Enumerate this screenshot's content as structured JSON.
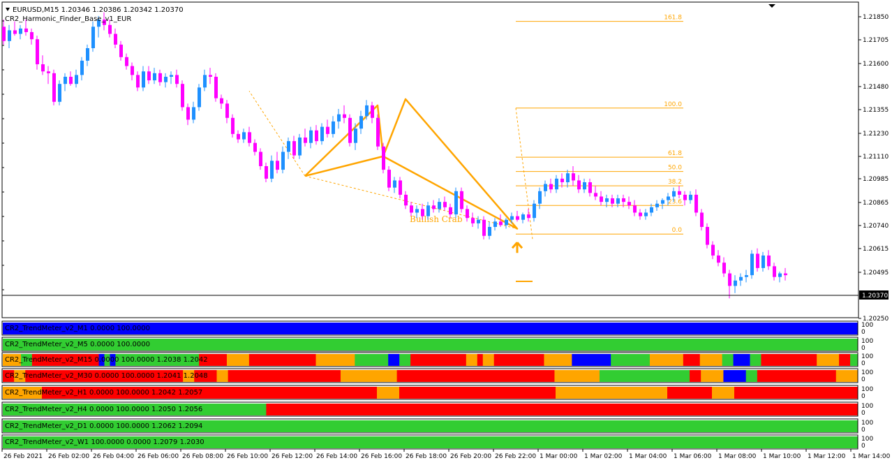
{
  "header": {
    "symbol_line": "EURUSD,M15  1.20346 1.20386 1.20342 1.20370",
    "indicator_name": "CR2_Harmonic_Finder_Base_v1_EUR"
  },
  "price_axis": {
    "labels": [
      "1.21850",
      "1.21705",
      "1.21600",
      "1.21480",
      "1.21355",
      "1.21230",
      "1.21110",
      "1.20985",
      "1.20865",
      "1.20740",
      "1.20615",
      "1.20495",
      "1.20250"
    ],
    "current_price": "1.20370"
  },
  "fibonacci": [
    {
      "level": "161.8"
    },
    {
      "level": "100.0"
    },
    {
      "level": "61.8"
    },
    {
      "level": "50.0"
    },
    {
      "level": "38.2"
    },
    {
      "level": "23.6"
    },
    {
      "level": "0.0"
    }
  ],
  "pattern_label": "Bullish Crab",
  "colors": {
    "bull": "#1E90FF",
    "bear": "#FF00FF",
    "pattern": "#FFA500",
    "red": "#FF0000",
    "green": "#32CD32",
    "orange": "#FFA500",
    "blue": "#0000FF"
  },
  "panels": [
    {
      "label": "CR2_TrendMeter_v2_M1 0.0000 100.0000",
      "scale_top": "100",
      "scale_bottom": "0",
      "segments": [
        {
          "color": "blue",
          "w": 1
        }
      ]
    },
    {
      "label": "CR2_TrendMeter_v2_M5 0.0000 100.0000",
      "scale_top": "100",
      "scale_bottom": "0",
      "segments": [
        {
          "color": "green",
          "w": 1
        }
      ]
    },
    {
      "label": "CR2_TrendMeter_v2_M15 0.0000 100.0000 1.2038 1.2042",
      "scale_top": "100",
      "scale_bottom": "0",
      "segments": [
        {
          "color": "orange",
          "w": 26
        },
        {
          "color": "green",
          "w": 16
        },
        {
          "color": "red",
          "w": 96
        },
        {
          "color": "blue",
          "w": 8
        },
        {
          "color": "green",
          "w": 8
        },
        {
          "color": "blue",
          "w": 8
        },
        {
          "color": "green",
          "w": 120
        },
        {
          "color": "red",
          "w": 40
        },
        {
          "color": "orange",
          "w": 32
        },
        {
          "color": "red",
          "w": 96
        },
        {
          "color": "orange",
          "w": 56
        },
        {
          "color": "green",
          "w": 48
        },
        {
          "color": "blue",
          "w": 16
        },
        {
          "color": "green",
          "w": 16
        },
        {
          "color": "red",
          "w": 80
        },
        {
          "color": "orange",
          "w": 16
        },
        {
          "color": "red",
          "w": 8
        },
        {
          "color": "orange",
          "w": 16
        },
        {
          "color": "red",
          "w": 72
        },
        {
          "color": "orange",
          "w": 40
        },
        {
          "color": "blue",
          "w": 56
        },
        {
          "color": "green",
          "w": 56
        },
        {
          "color": "orange",
          "w": 48
        },
        {
          "color": "red",
          "w": 24
        },
        {
          "color": "orange",
          "w": 8
        },
        {
          "color": "orange",
          "w": 24
        },
        {
          "color": "green",
          "w": 16
        },
        {
          "color": "blue",
          "w": 24
        },
        {
          "color": "green",
          "w": 16
        },
        {
          "color": "red",
          "w": 80
        },
        {
          "color": "orange",
          "w": 32
        },
        {
          "color": "red",
          "w": 16
        },
        {
          "color": "green",
          "w": 10
        }
      ]
    },
    {
      "label": "CR2_TrendMeter_v2_M30 0.0000 100.0000 1.2041 1.2048",
      "scale_top": "100",
      "scale_bottom": "0",
      "segments": [
        {
          "color": "red",
          "w": 16
        },
        {
          "color": "orange",
          "w": 16
        },
        {
          "color": "red",
          "w": 224
        },
        {
          "color": "orange",
          "w": 16
        },
        {
          "color": "red",
          "w": 32
        },
        {
          "color": "orange",
          "w": 16
        },
        {
          "color": "red",
          "w": 160
        },
        {
          "color": "orange",
          "w": 80
        },
        {
          "color": "red",
          "w": 224
        },
        {
          "color": "orange",
          "w": 64
        },
        {
          "color": "green",
          "w": 128
        },
        {
          "color": "red",
          "w": 16
        },
        {
          "color": "orange",
          "w": 32
        },
        {
          "color": "blue",
          "w": 32
        },
        {
          "color": "green",
          "w": 16
        },
        {
          "color": "red",
          "w": 112
        },
        {
          "color": "orange",
          "w": 30
        }
      ]
    },
    {
      "label": "CR2_TrendMeter_v2_H1 0.0000 100.0000 1.2042 1.2057",
      "scale_top": "100",
      "scale_bottom": "0",
      "segments": [
        {
          "color": "orange",
          "w": 56
        },
        {
          "color": "red",
          "w": 480
        },
        {
          "color": "orange",
          "w": 32
        },
        {
          "color": "red",
          "w": 224
        },
        {
          "color": "orange",
          "w": 160
        },
        {
          "color": "red",
          "w": 64
        },
        {
          "color": "orange",
          "w": 32
        },
        {
          "color": "red",
          "w": 176
        }
      ]
    },
    {
      "label": "CR2_TrendMeter_v2_H4 0.0000 100.0000 1.2050 1.2056",
      "scale_top": "100",
      "scale_bottom": "0",
      "segments": [
        {
          "color": "green",
          "w": 378
        },
        {
          "color": "red",
          "w": 848
        }
      ]
    },
    {
      "label": "CR2_TrendMeter_v2_D1 0.0000 100.0000 1.2062 1.2094",
      "scale_top": "100",
      "scale_bottom": "0",
      "segments": [
        {
          "color": "green",
          "w": 1
        }
      ]
    },
    {
      "label": "CR2_TrendMeter_v2_W1 100.0000 0.0000 1.2079 1.2030",
      "scale_top": "100",
      "scale_bottom": "0",
      "segments": [
        {
          "color": "green",
          "w": 1
        }
      ]
    }
  ],
  "time_axis": [
    "26 Feb 2021",
    "26 Feb 02:00",
    "26 Feb 04:00",
    "26 Feb 06:00",
    "26 Feb 08:00",
    "26 Feb 10:00",
    "26 Feb 12:00",
    "26 Feb 14:00",
    "26 Feb 16:00",
    "26 Feb 18:00",
    "26 Feb 20:00",
    "26 Feb 22:00",
    "1 Mar 00:00",
    "1 Mar 02:00",
    "1 Mar 04:00",
    "1 Mar 06:00",
    "1 Mar 08:00",
    "1 Mar 10:00",
    "1 Mar 12:00",
    "1 Mar 14:00"
  ],
  "chart_data": {
    "type": "candlestick",
    "title": "EURUSD,M15",
    "ohlc": [
      [
        1.2182,
        1.2186,
        1.2172,
        1.2174
      ],
      [
        1.2174,
        1.2183,
        1.217,
        1.218
      ],
      [
        1.218,
        1.2185,
        1.2177,
        1.2178
      ],
      [
        1.2178,
        1.2183,
        1.2175,
        1.2181
      ],
      [
        1.2181,
        1.2186,
        1.2177,
        1.2179
      ],
      [
        1.2179,
        1.2181,
        1.2172,
        1.2175
      ],
      [
        1.2175,
        1.2177,
        1.2158,
        1.2161
      ],
      [
        1.2161,
        1.2166,
        1.2155,
        1.2157
      ],
      [
        1.2157,
        1.216,
        1.215,
        1.2156
      ],
      [
        1.2156,
        1.2158,
        1.2138,
        1.214
      ],
      [
        1.214,
        1.2152,
        1.2138,
        1.215
      ],
      [
        1.215,
        1.2156,
        1.2146,
        1.2154
      ],
      [
        1.2154,
        1.2157,
        1.2149,
        1.215
      ],
      [
        1.215,
        1.2158,
        1.2148,
        1.2155
      ],
      [
        1.2155,
        1.2165,
        1.2152,
        1.2163
      ],
      [
        1.2163,
        1.2172,
        1.216,
        1.217
      ],
      [
        1.217,
        1.2185,
        1.2168,
        1.2182
      ],
      [
        1.2182,
        1.2188,
        1.2176,
        1.2186
      ],
      [
        1.2186,
        1.219,
        1.218,
        1.2183
      ],
      [
        1.2183,
        1.2186,
        1.2176,
        1.2178
      ],
      [
        1.2178,
        1.2181,
        1.217,
        1.2172
      ],
      [
        1.2172,
        1.2174,
        1.2163,
        1.2165
      ],
      [
        1.2165,
        1.2167,
        1.2158,
        1.216
      ],
      [
        1.216,
        1.2162,
        1.2152,
        1.2155
      ],
      [
        1.2155,
        1.2157,
        1.2146,
        1.2148
      ],
      [
        1.2148,
        1.216,
        1.2146,
        1.2157
      ],
      [
        1.2157,
        1.216,
        1.215,
        1.2152
      ],
      [
        1.2152,
        1.2159,
        1.215,
        1.2156
      ],
      [
        1.2156,
        1.2158,
        1.2149,
        1.2151
      ],
      [
        1.2151,
        1.2156,
        1.2148,
        1.2154
      ],
      [
        1.2154,
        1.2157,
        1.215,
        1.2155
      ],
      [
        1.2155,
        1.2158,
        1.2148,
        1.215
      ],
      [
        1.215,
        1.2152,
        1.2135,
        1.2137
      ],
      [
        1.2137,
        1.2139,
        1.2127,
        1.213
      ],
      [
        1.213,
        1.214,
        1.2128,
        1.2137
      ],
      [
        1.2137,
        1.215,
        1.2135,
        1.2148
      ],
      [
        1.2148,
        1.2158,
        1.2146,
        1.2155
      ],
      [
        1.2155,
        1.2159,
        1.215,
        1.2154
      ],
      [
        1.2154,
        1.2156,
        1.214,
        1.2142
      ],
      [
        1.2142,
        1.2144,
        1.2136,
        1.2139
      ],
      [
        1.2139,
        1.2141,
        1.2128,
        1.2131
      ],
      [
        1.2131,
        1.2133,
        1.212,
        1.2122
      ],
      [
        1.2122,
        1.2124,
        1.2117,
        1.2119
      ],
      [
        1.2119,
        1.2125,
        1.2117,
        1.2123
      ],
      [
        1.2123,
        1.2126,
        1.2115,
        1.2117
      ],
      [
        1.2117,
        1.2119,
        1.211,
        1.2112
      ],
      [
        1.2112,
        1.2114,
        1.2102,
        1.2104
      ],
      [
        1.2104,
        1.2106,
        1.2095,
        1.2097
      ],
      [
        1.2097,
        1.211,
        1.2095,
        1.2107
      ],
      [
        1.2107,
        1.2112,
        1.21,
        1.2102
      ],
      [
        1.2102,
        1.2115,
        1.21,
        1.2112
      ],
      [
        1.2112,
        1.212,
        1.2108,
        1.2118
      ],
      [
        1.2118,
        1.2121,
        1.2108,
        1.211
      ],
      [
        1.211,
        1.2122,
        1.2108,
        1.212
      ],
      [
        1.212,
        1.2125,
        1.2115,
        1.2117
      ],
      [
        1.2117,
        1.2126,
        1.2114,
        1.2124
      ],
      [
        1.2124,
        1.2127,
        1.2116,
        1.2118
      ],
      [
        1.2118,
        1.2128,
        1.2116,
        1.2126
      ],
      [
        1.2126,
        1.213,
        1.212,
        1.2122
      ],
      [
        1.2122,
        1.2132,
        1.212,
        1.2129
      ],
      [
        1.2129,
        1.2136,
        1.2125,
        1.2133
      ],
      [
        1.2133,
        1.2138,
        1.2128,
        1.2131
      ],
      [
        1.2131,
        1.2133,
        1.2115,
        1.2117
      ],
      [
        1.2117,
        1.2128,
        1.2113,
        1.2125
      ],
      [
        1.2125,
        1.2135,
        1.2122,
        1.2132
      ],
      [
        1.2132,
        1.2141,
        1.213,
        1.2138
      ],
      [
        1.2138,
        1.214,
        1.2128,
        1.2131
      ],
      [
        1.2131,
        1.2133,
        1.2113,
        1.2115
      ],
      [
        1.2115,
        1.2117,
        1.21,
        1.2102
      ],
      [
        1.2102,
        1.2104,
        1.209,
        1.2092
      ],
      [
        1.2092,
        1.2098,
        1.2089,
        1.2096
      ],
      [
        1.2096,
        1.2098,
        1.2086,
        1.2088
      ],
      [
        1.2088,
        1.209,
        1.208,
        1.2082
      ],
      [
        1.2082,
        1.2084,
        1.2076,
        1.2078
      ],
      [
        1.2078,
        1.2082,
        1.2075,
        1.208
      ],
      [
        1.208,
        1.2083,
        1.2074,
        1.2076
      ],
      [
        1.2076,
        1.2084,
        1.2074,
        1.2082
      ],
      [
        1.2082,
        1.2085,
        1.2078,
        1.208
      ],
      [
        1.208,
        1.2086,
        1.2078,
        1.2084
      ],
      [
        1.2084,
        1.2087,
        1.2079,
        1.2081
      ],
      [
        1.2081,
        1.2083,
        1.2075,
        1.2077
      ],
      [
        1.2077,
        1.2092,
        1.2075,
        1.209
      ],
      [
        1.209,
        1.2092,
        1.2078,
        1.208
      ],
      [
        1.208,
        1.2082,
        1.2073,
        1.2075
      ],
      [
        1.2075,
        1.2078,
        1.207,
        1.2072
      ],
      [
        1.2072,
        1.2076,
        1.2069,
        1.2074
      ],
      [
        1.2074,
        1.2076,
        1.2063,
        1.2065
      ],
      [
        1.2065,
        1.2073,
        1.2063,
        1.207
      ],
      [
        1.207,
        1.2075,
        1.2068,
        1.2073
      ],
      [
        1.2073,
        1.2077,
        1.207,
        1.2071
      ],
      [
        1.2071,
        1.2075,
        1.2069,
        1.2074
      ],
      [
        1.2074,
        1.2078,
        1.2072,
        1.2076
      ],
      [
        1.2076,
        1.2079,
        1.2073,
        1.2074
      ],
      [
        1.2074,
        1.2078,
        1.2072,
        1.2077
      ],
      [
        1.2077,
        1.208,
        1.2073,
        1.2075
      ],
      [
        1.2075,
        1.2085,
        1.2073,
        1.2083
      ],
      [
        1.2083,
        1.2092,
        1.208,
        1.209
      ],
      [
        1.209,
        1.2096,
        1.2087,
        1.2094
      ],
      [
        1.2094,
        1.2097,
        1.2089,
        1.2091
      ],
      [
        1.2091,
        1.2099,
        1.2089,
        1.2097
      ],
      [
        1.2097,
        1.21,
        1.2092,
        1.2095
      ],
      [
        1.2095,
        1.2102,
        1.2092,
        1.21
      ],
      [
        1.21,
        1.2104,
        1.2093,
        1.2096
      ],
      [
        1.2096,
        1.2099,
        1.2089,
        1.2091
      ],
      [
        1.2091,
        1.2097,
        1.2089,
        1.2095
      ],
      [
        1.2095,
        1.2097,
        1.2087,
        1.2089
      ],
      [
        1.2089,
        1.2093,
        1.2085,
        1.2087
      ],
      [
        1.2087,
        1.209,
        1.2082,
        1.2084
      ],
      [
        1.2084,
        1.2088,
        1.2081,
        1.2086
      ],
      [
        1.2086,
        1.2088,
        1.2081,
        1.2083
      ],
      [
        1.2083,
        1.2088,
        1.2081,
        1.2086
      ],
      [
        1.2086,
        1.2088,
        1.2081,
        1.2084
      ],
      [
        1.2084,
        1.2087,
        1.208,
        1.2082
      ],
      [
        1.2082,
        1.2085,
        1.2076,
        1.2078
      ],
      [
        1.2078,
        1.208,
        1.2074,
        1.2076
      ],
      [
        1.2076,
        1.208,
        1.2074,
        1.2078
      ],
      [
        1.2078,
        1.2083,
        1.2076,
        1.2081
      ],
      [
        1.2081,
        1.2085,
        1.2079,
        1.2083
      ],
      [
        1.2083,
        1.2086,
        1.208,
        1.2085
      ],
      [
        1.2085,
        1.2089,
        1.2082,
        1.2087
      ],
      [
        1.2087,
        1.2092,
        1.2084,
        1.209
      ],
      [
        1.209,
        1.2093,
        1.2086,
        1.2088
      ],
      [
        1.2088,
        1.209,
        1.2082,
        1.2085
      ],
      [
        1.2085,
        1.209,
        1.2083,
        1.2088
      ],
      [
        1.2088,
        1.2091,
        1.2076,
        1.2078
      ],
      [
        1.2078,
        1.208,
        1.2068,
        1.207
      ],
      [
        1.207,
        1.2072,
        1.2058,
        1.206
      ],
      [
        1.206,
        1.2062,
        1.2052,
        1.2054
      ],
      [
        1.2054,
        1.2057,
        1.2048,
        1.205
      ],
      [
        1.205,
        1.2053,
        1.2042,
        1.2044
      ],
      [
        1.2044,
        1.2046,
        1.203,
        1.2037
      ],
      [
        1.2037,
        1.2043,
        1.2033,
        1.204
      ],
      [
        1.204,
        1.2044,
        1.2037,
        1.2042
      ],
      [
        1.2042,
        1.2046,
        1.2039,
        1.2043
      ],
      [
        1.2043,
        1.2057,
        1.2041,
        1.2055
      ],
      [
        1.2055,
        1.2058,
        1.2045,
        1.2047
      ],
      [
        1.2047,
        1.2056,
        1.2045,
        1.2054
      ],
      [
        1.2054,
        1.2057,
        1.2046,
        1.2048
      ],
      [
        1.2048,
        1.205,
        1.204,
        1.2042
      ],
      [
        1.2042,
        1.2045,
        1.2039,
        1.2044
      ],
      [
        1.2044,
        1.2047,
        1.204,
        1.2043
      ]
    ],
    "harmonic_pattern": {
      "name": "Bullish Crab",
      "X": {
        "bar": 54,
        "price": 1.20985
      },
      "A": {
        "bar": 67,
        "price": 1.2138
      },
      "B": {
        "bar": 68,
        "price": 1.21095
      },
      "C": {
        "bar": 72,
        "price": 1.21415
      },
      "D": {
        "bar": 92,
        "price": 1.2069
      }
    },
    "fib_levels": [
      {
        "level": "161.8",
        "price": 1.2185
      },
      {
        "level": "100.0",
        "price": 1.21365
      },
      {
        "level": "61.8",
        "price": 1.2109
      },
      {
        "level": "50.0",
        "price": 1.2101
      },
      {
        "level": "38.2",
        "price": 1.2093
      },
      {
        "level": "23.6",
        "price": 1.2082
      },
      {
        "level": "0.0",
        "price": 1.2066
      }
    ],
    "current_price": 1.2037,
    "price_range": [
      1.202,
      1.2195
    ]
  }
}
